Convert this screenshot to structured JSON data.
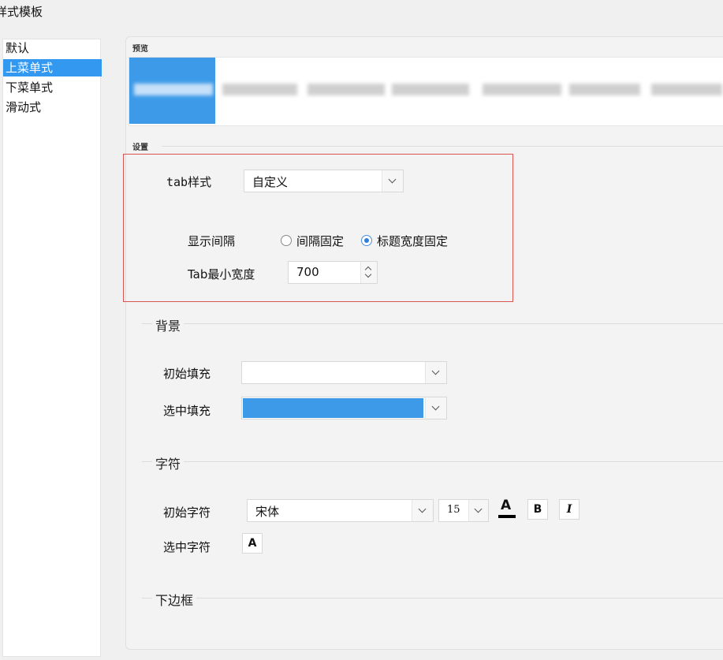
{
  "window": {
    "title": "样式模板"
  },
  "sidebar": {
    "items": [
      {
        "label": "默认"
      },
      {
        "label": "上菜单式",
        "selected": true
      },
      {
        "label": "下菜单式"
      },
      {
        "label": "滑动式"
      }
    ],
    "accent_color": "#3398f0"
  },
  "preview": {
    "label": "预览",
    "selected_color": "#3d9ae8"
  },
  "settings": {
    "label": "设置",
    "tab_style": {
      "label": "tab样式",
      "value": "自定义"
    },
    "display_interval": {
      "label": "显示间隔",
      "options": [
        {
          "label": "间隔固定",
          "selected": false
        },
        {
          "label": "标题宽度固定",
          "selected": true
        }
      ]
    },
    "tab_min_width": {
      "label": "Tab最小宽度",
      "value": "700"
    }
  },
  "background": {
    "label": "背景",
    "initial_fill": {
      "label": "初始填充",
      "color": "#ffffff"
    },
    "selected_fill": {
      "label": "选中填充",
      "color": "#3d9ae8"
    }
  },
  "characters": {
    "label": "字符",
    "initial_char": {
      "label": "初始字符",
      "font": "宋体",
      "size": "15",
      "color_btn": "A",
      "bold_btn": "B",
      "italic_btn": "I"
    },
    "selected_char": {
      "label": "选中字符",
      "color_btn": "A"
    }
  },
  "bottom_border": {
    "label": "下边框"
  },
  "colors": {
    "highlight_border": "#d9534f"
  }
}
